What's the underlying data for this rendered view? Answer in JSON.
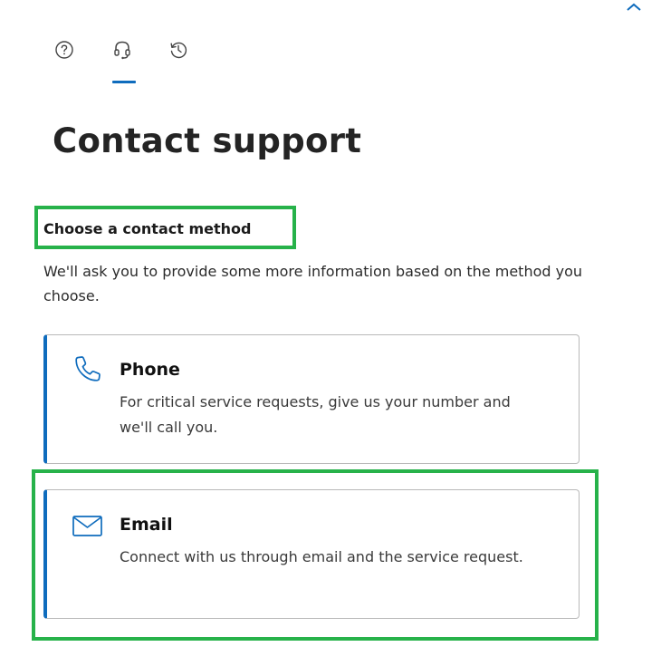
{
  "header": {
    "tabs": [
      {
        "icon": "help-icon",
        "selected": false
      },
      {
        "icon": "headset-icon",
        "selected": true
      },
      {
        "icon": "history-icon",
        "selected": false
      }
    ],
    "collapse_icon": "chevron-up-icon"
  },
  "page": {
    "title": "Contact support"
  },
  "contact_method": {
    "heading": "Choose a contact method",
    "description": "We'll ask you to provide some more information based on the method you choose.",
    "methods": [
      {
        "icon": "phone-icon",
        "title": "Phone",
        "description": "For critical service requests, give us your number and we'll call you."
      },
      {
        "icon": "mail-icon",
        "title": "Email",
        "description": "Connect with us through email and the service request."
      }
    ]
  },
  "colors": {
    "accent": "#0f6cbd",
    "highlight": "#27b24a",
    "text": "#1b1b1b"
  }
}
